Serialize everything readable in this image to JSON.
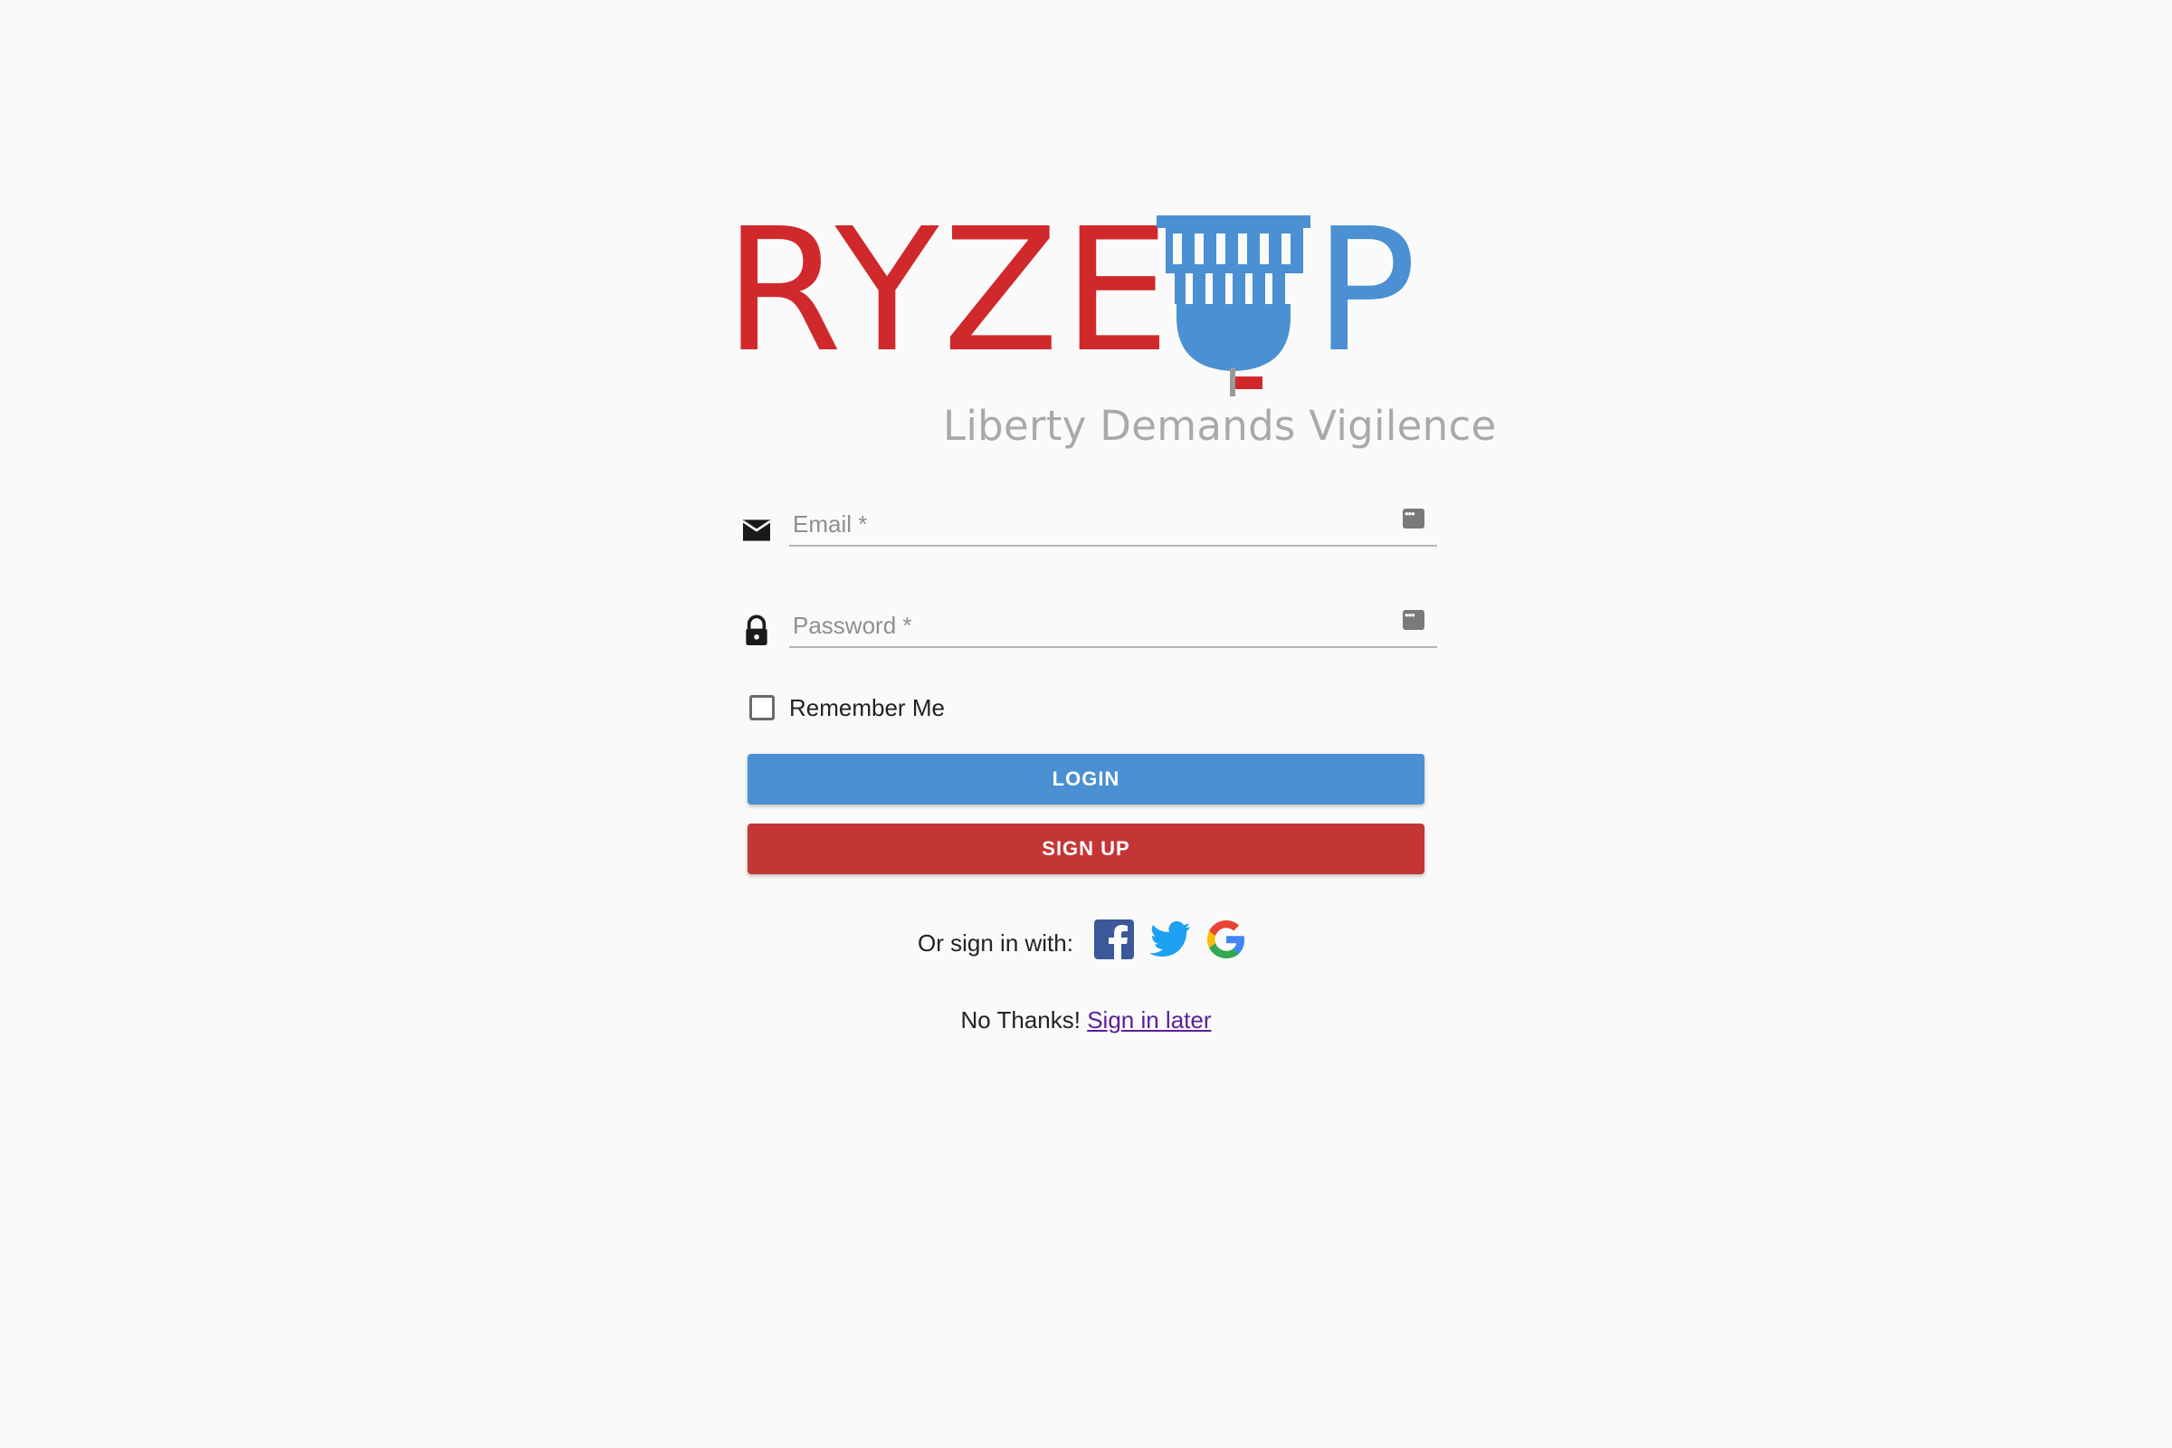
{
  "logo": {
    "word": "RYZE",
    "p": "P",
    "tagline": "Liberty Demands Vigilence",
    "colors": {
      "red": "#d0292c",
      "blue": "#4a90d2"
    }
  },
  "form": {
    "email": {
      "label": "Email *",
      "value": "",
      "icon": "email-icon"
    },
    "password": {
      "label": "Password *",
      "value": "",
      "icon": "lock-icon"
    },
    "remember_me": {
      "label": "Remember Me",
      "checked": false
    }
  },
  "buttons": {
    "login": "LOGIN",
    "signup": "SIGN UP",
    "colors": {
      "login": "#4a90d2",
      "signup": "#c43636"
    }
  },
  "social": {
    "label": "Or sign in with:",
    "providers": [
      "facebook-icon",
      "twitter-icon",
      "google-icon"
    ]
  },
  "later": {
    "prefix": "No Thanks!",
    "link": "Sign in later"
  }
}
